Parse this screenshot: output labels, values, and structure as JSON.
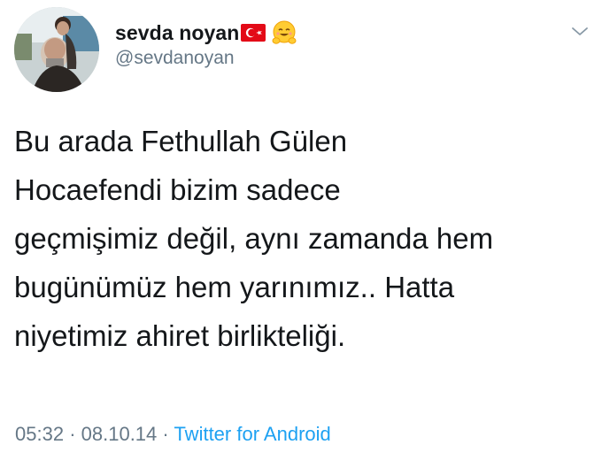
{
  "user": {
    "display_name": "sevda noyan",
    "handle": "@sevdanoyan",
    "flag_icon": "turkey-flag-icon",
    "emoji_icon": "hugging-face-emoji"
  },
  "tweet": {
    "text": "Bu arada Fethullah Gülen\nHocaefendi bizim sadece\ngeçmişimiz değil, aynı zamanda hem\nbugünümüz hem yarınımız.. Hatta\nniyetimiz ahiret birlikteliği."
  },
  "meta": {
    "time": "05:32",
    "sep1": "·",
    "date": "08.10.14",
    "sep2": "·",
    "source": "Twitter for Android"
  },
  "colors": {
    "name": "#14171a",
    "secondary": "#657786",
    "link": "#1da1f2",
    "flag_red": "#e30a17"
  }
}
